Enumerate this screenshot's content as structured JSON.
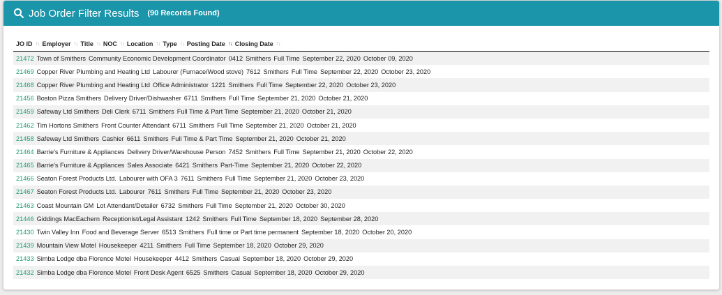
{
  "header": {
    "title": "Job Order Filter Results",
    "count": "(90 Records Found)",
    "accent": "#1a95aa"
  },
  "columns": [
    "JO ID",
    "Employer",
    "Title",
    "NOC",
    "Location",
    "Type",
    "Posting Date",
    "Closing Date"
  ],
  "rows": [
    {
      "id": "21472",
      "employer": "Town of Smithers",
      "title": "Community Economic Development Coordinator",
      "noc": "0412",
      "location": "Smithers",
      "type": "Full Time",
      "posting": "September 22, 2020",
      "closing": "October 09, 2020"
    },
    {
      "id": "21469",
      "employer": "Copper River Plumbing and Heating Ltd",
      "title": "Labourer (Furnace/Wood stove)",
      "noc": "7612",
      "location": "Smithers",
      "type": "Full Time",
      "posting": "September 22, 2020",
      "closing": "October 23, 2020"
    },
    {
      "id": "21468",
      "employer": "Copper River Plumbing and Heating Ltd",
      "title": "Office Administrator",
      "noc": "1221",
      "location": "Smithers",
      "type": "Full Time",
      "posting": "September 22, 2020",
      "closing": "October 23, 2020"
    },
    {
      "id": "21456",
      "employer": "Boston Pizza Smithers",
      "title": "Delivery Driver/Dishwasher",
      "noc": "6711",
      "location": "Smithers",
      "type": "Full Time",
      "posting": "September 21, 2020",
      "closing": "October 21, 2020"
    },
    {
      "id": "21459",
      "employer": "Safeway Ltd Smithers",
      "title": "Deli Clerk",
      "noc": "6711",
      "location": "Smithers",
      "type": "Full Time & Part Time",
      "posting": "September 21, 2020",
      "closing": "October 21, 2020"
    },
    {
      "id": "21462",
      "employer": "Tim Hortons Smithers",
      "title": "Front Counter Attendant",
      "noc": "6711",
      "location": "Smithers",
      "type": "Full Time",
      "posting": "September 21, 2020",
      "closing": "October 21, 2020"
    },
    {
      "id": "21458",
      "employer": "Safeway Ltd Smithers",
      "title": "Cashier",
      "noc": "6611",
      "location": "Smithers",
      "type": "Full Time & Part Time",
      "posting": "September 21, 2020",
      "closing": "October 21, 2020"
    },
    {
      "id": "21464",
      "employer": "Barrie's Furniture & Appliances",
      "title": "Delivery Driver/Warehouse Person",
      "noc": "7452",
      "location": "Smithers",
      "type": "Full Time",
      "posting": "September 21, 2020",
      "closing": "October 22, 2020"
    },
    {
      "id": "21465",
      "employer": "Barrie's Furniture & Appliances",
      "title": "Sales Associate",
      "noc": "6421",
      "location": "Smithers",
      "type": "Part-Time",
      "posting": "September 21, 2020",
      "closing": "October 22, 2020"
    },
    {
      "id": "21466",
      "employer": "Seaton Forest Products Ltd.",
      "title": "Labourer with OFA 3",
      "noc": "7611",
      "location": "Smithers",
      "type": "Full Time",
      "posting": "September 21, 2020",
      "closing": "October 23, 2020"
    },
    {
      "id": "21467",
      "employer": "Seaton Forest Products Ltd.",
      "title": "Labourer",
      "noc": "7611",
      "location": "Smithers",
      "type": "Full Time",
      "posting": "September 21, 2020",
      "closing": "October 23, 2020"
    },
    {
      "id": "21463",
      "employer": "Coast Mountain GM",
      "title": "Lot Attendant/Detailer",
      "noc": "6732",
      "location": "Smithers",
      "type": "Full Time",
      "posting": "September 21, 2020",
      "closing": "October 30, 2020"
    },
    {
      "id": "21446",
      "employer": "Giddings MacEachern",
      "title": "Receptionist/Legal Assistant",
      "noc": "1242",
      "location": "Smithers",
      "type": "Full Time",
      "posting": "September 18, 2020",
      "closing": "September 28, 2020"
    },
    {
      "id": "21430",
      "employer": "Twin Valley Inn",
      "title": "Food and Beverage Server",
      "noc": "6513",
      "location": "Smithers",
      "type": "Full time or Part time permanent",
      "posting": "September 18, 2020",
      "closing": "October 20, 2020"
    },
    {
      "id": "21439",
      "employer": "Mountain View Motel",
      "title": "Housekeeper",
      "noc": "4211",
      "location": "Smithers",
      "type": "Full Time",
      "posting": "September 18, 2020",
      "closing": "October 29, 2020"
    },
    {
      "id": "21433",
      "employer": "Simba Lodge dba Florence Motel",
      "title": "Housekeeper",
      "noc": "4412",
      "location": "Smithers",
      "type": "Casual",
      "posting": "September 18, 2020",
      "closing": "October 29, 2020"
    },
    {
      "id": "21432",
      "employer": "Simba Lodge dba Florence Motel",
      "title": "Front Desk Agent",
      "noc": "6525",
      "location": "Smithers",
      "type": "Casual",
      "posting": "September 18, 2020",
      "closing": "October 29, 2020"
    }
  ]
}
